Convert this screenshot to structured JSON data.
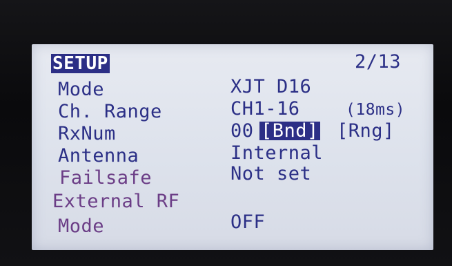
{
  "screen": {
    "title": "SETUP",
    "page_indicator": "2/13"
  },
  "rows": [
    {
      "label": "Mode",
      "value": "XJT D16"
    },
    {
      "label": "Ch. Range",
      "value": "CH1-16",
      "extra": "(18ms)"
    },
    {
      "label": "RxNum",
      "value": "00",
      "buttons": [
        "[Bnd]",
        "[Rng]"
      ]
    },
    {
      "label": "Antenna",
      "value": "Internal"
    },
    {
      "label": "Failsafe",
      "value": "Not set"
    }
  ],
  "external_rf": {
    "section_label": "External RF",
    "mode_label": "Mode",
    "mode_value": "OFF"
  },
  "colors": {
    "lcd_background": "#e2e6ee",
    "text_blue": "#2b2f86",
    "text_purple": "#6b3d86",
    "highlight": "#2c2f86"
  }
}
